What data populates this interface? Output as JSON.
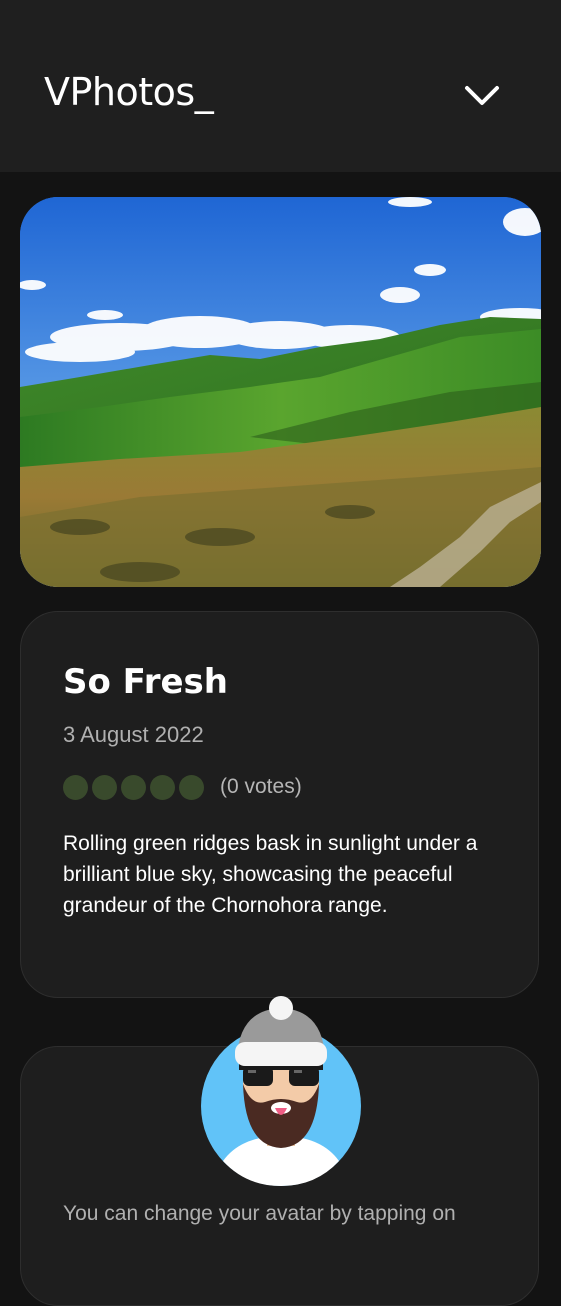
{
  "header": {
    "logo_text": "VPhotos_",
    "menu_icon": "chevron-down-icon"
  },
  "photo": {
    "alt": "Rolling green ridges under a blue sky"
  },
  "details": {
    "title": "So Fresh",
    "date": "3 August 2022",
    "rating": {
      "stars_filled": 0,
      "stars_total": 5,
      "votes_text": "(0 votes)"
    },
    "description": "Rolling green ridges bask in sunlight under a brilliant blue sky, showcasing the peaceful grandeur of the Chornohora range."
  },
  "avatar_section": {
    "hint": "You can change your avatar by tapping on"
  },
  "colors": {
    "background": "#131313",
    "header": "#1f1f1f",
    "card": "#1e1e1e",
    "star_empty": "#394a2c",
    "avatar_bg": "#61c3f8"
  }
}
